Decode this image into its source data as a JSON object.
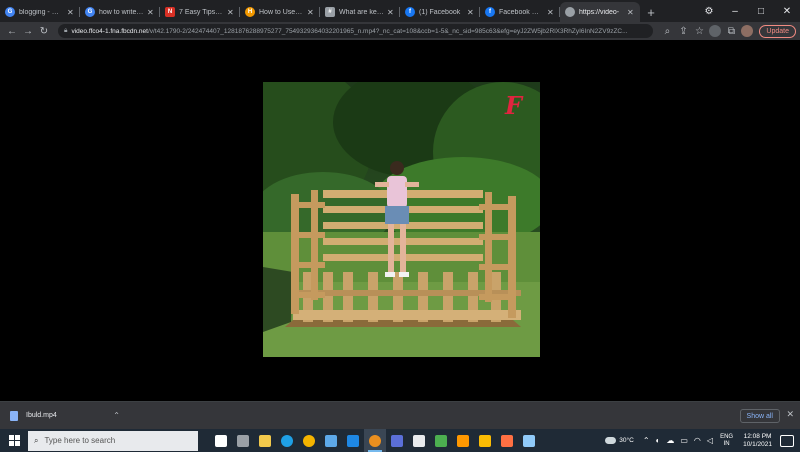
{
  "browser": {
    "tabs": [
      {
        "title": "blogging - Goog",
        "fav_color": "#4285f4",
        "fav_glyph": "G",
        "active": false
      },
      {
        "title": "how to write a g",
        "fav_color": "#4285f4",
        "fav_glyph": "G",
        "active": false
      },
      {
        "title": "7 Easy Tips for E",
        "fav_color": "#d93025",
        "fav_glyph": "N",
        "active": false
      },
      {
        "title": "How to Use Keyw",
        "fav_color": "#f29900",
        "fav_glyph": "H",
        "active": false
      },
      {
        "title": "What are keywo",
        "fav_color": "#9aa0a6",
        "fav_glyph": "#",
        "active": false
      },
      {
        "title": "(1) Facebook",
        "fav_color": "#1877f2",
        "fav_glyph": "f",
        "active": false
      },
      {
        "title": "Facebook Watch",
        "fav_color": "#1877f2",
        "fav_glyph": "f",
        "active": false
      },
      {
        "title": "https://video-",
        "fav_color": "#9aa0a6",
        "fav_glyph": "",
        "active": true
      }
    ],
    "new_tab_glyph": "+",
    "window_controls": {
      "menu": "⚙",
      "minimize": "–",
      "maximize": "□",
      "close": "✕"
    },
    "url_host": "video.ffco4-1.fna.fbcdn.net",
    "url_path": "/v/t42.1790-2/242474407_1281876288975277_7549329364032201965_n.mp4?_nc_cat=108&ccb=1-5&_nc_sid=985c63&efg=eyJ2ZW5jb2RlX3RhZyI6InN2ZV9zZC...",
    "update_label": "Update"
  },
  "video": {
    "watermark": "F",
    "accent_color": "#e0243f"
  },
  "downloads": {
    "file_name": "Ibuld.mp4",
    "show_all_label": "Show all",
    "close_glyph": "✕"
  },
  "taskbar": {
    "search_placeholder": "Type here to search",
    "apps": [
      {
        "name": "task-view",
        "color": "#ffffff"
      },
      {
        "name": "widgets",
        "color": "#9aa0a6"
      },
      {
        "name": "file-explorer",
        "color": "#f2c94c"
      },
      {
        "name": "edge",
        "color": "#1fa0e6"
      },
      {
        "name": "chrome",
        "color": "#f4b400"
      },
      {
        "name": "store",
        "color": "#5da9e9"
      },
      {
        "name": "vscode",
        "color": "#1e88e5"
      },
      {
        "name": "chrome-active",
        "color": "#ea8f1f"
      },
      {
        "name": "teams",
        "color": "#5b6fd8"
      },
      {
        "name": "app-10",
        "color": "#e8eaed"
      },
      {
        "name": "paint",
        "color": "#4caf50"
      },
      {
        "name": "app-12",
        "color": "#ff9800"
      },
      {
        "name": "app-13",
        "color": "#fbbc04"
      },
      {
        "name": "app-14",
        "color": "#ff7043"
      },
      {
        "name": "app-15",
        "color": "#90caf9"
      }
    ],
    "weather": "30°C",
    "language_top": "ENG",
    "language_bottom": "IN",
    "time": "12:08 PM",
    "date": "10/1/2021"
  }
}
